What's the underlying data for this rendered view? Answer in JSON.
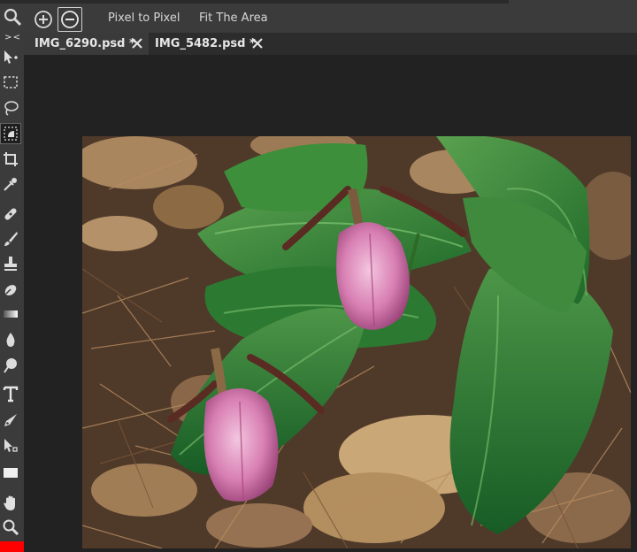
{
  "options_bar": {
    "pixel_to_pixel_label": "Pixel to Pixel",
    "fit_area_label": "Fit The Area"
  },
  "toolbar": {
    "collapse_label": "> <",
    "foreground_color": "#ff0000"
  },
  "tabs": [
    {
      "label": "IMG_6290.psd *",
      "active": true
    },
    {
      "label": "IMG_5482.psd *",
      "active": false
    }
  ],
  "tools": [
    "move-tool-icon",
    "rectangular-select-icon",
    "lasso-icon",
    "quick-select-icon",
    "crop-icon",
    "eyedropper-icon",
    "healing-icon",
    "brush-icon",
    "clone-stamp-icon",
    "eraser-icon",
    "gradient-icon",
    "blur-icon",
    "dodge-icon",
    "text-icon",
    "pen-icon",
    "path-select-icon",
    "shape-icon",
    "hand-icon",
    "zoom-icon"
  ]
}
